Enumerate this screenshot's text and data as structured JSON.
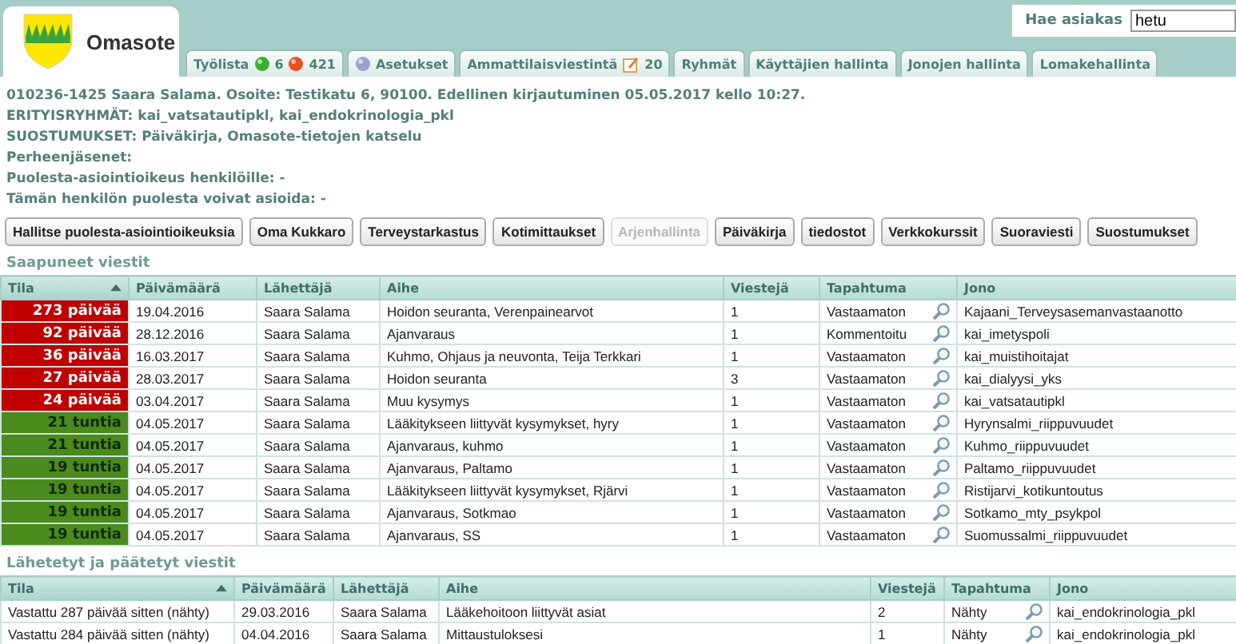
{
  "header": {
    "app_name": "Omasote",
    "search": {
      "label": "Hae asiakas",
      "value": "hetu"
    },
    "tabs": [
      {
        "kind": "worklist",
        "label": "Työlista",
        "green_count": "6",
        "red_count": "421"
      },
      {
        "kind": "settings",
        "label": "Asetukset"
      },
      {
        "kind": "messages",
        "label": "Ammattilaisviestintä",
        "count": "20"
      },
      {
        "kind": "plain",
        "label": "Ryhmät"
      },
      {
        "kind": "plain",
        "label": "Käyttäjien hallinta"
      },
      {
        "kind": "plain",
        "label": "Jonojen hallinta"
      },
      {
        "kind": "plain",
        "label": "Lomakehallinta"
      }
    ]
  },
  "patient_info": [
    "010236-1425 Saara Salama. Osoite: Testikatu 6, 90100. Edellinen kirjautuminen 05.05.2017 kello 10:27.",
    "ERITYISRYHMÄT: kai_vatsatautipkl, kai_endokrinologia_pkl",
    "SUOSTUMUKSET: Päiväkirja, Omasote-tietojen katselu",
    "Perheenjäsenet:",
    "Puolesta-asiointioikeus henkilöille: -",
    "Tämän henkilön puolesta voivat asioida: -"
  ],
  "buttons": [
    {
      "label": "Hallitse puolesta-asiointioikeuksia",
      "disabled": false
    },
    {
      "label": "Oma Kukkaro",
      "disabled": false
    },
    {
      "label": "Terveystarkastus",
      "disabled": false
    },
    {
      "label": "Kotimittaukset",
      "disabled": false
    },
    {
      "label": "Arjenhallinta",
      "disabled": true
    },
    {
      "label": "Päiväkirja",
      "disabled": false
    },
    {
      "label": "tiedostot",
      "disabled": false
    },
    {
      "label": "Verkkokurssit",
      "disabled": false
    },
    {
      "label": "Suoraviesti",
      "disabled": false
    },
    {
      "label": "Suostumukset",
      "disabled": false
    }
  ],
  "received": {
    "title": "Saapuneet viestit",
    "columns": [
      {
        "label": "Tila",
        "sorted": true
      },
      {
        "label": "Päivämäärä",
        "sorted": false
      },
      {
        "label": "Lähettäjä",
        "sorted": false
      },
      {
        "label": "Aihe",
        "sorted": false
      },
      {
        "label": "Viestejä",
        "sorted": false
      },
      {
        "label": "Tapahtuma",
        "sorted": false
      },
      {
        "label": "Jono",
        "sorted": false
      }
    ],
    "rows": [
      {
        "status": "273 päivää",
        "color": "#c00000",
        "date": "19.04.2016",
        "sender": "Saara Salama",
        "subject": "Hoidon seuranta, Verenpainearvot",
        "count": "1",
        "event": "Vastaamaton",
        "queue": "Kajaani_Terveysasemanvastaanotto"
      },
      {
        "status": "92 päivää",
        "color": "#c00000",
        "date": "28.12.2016",
        "sender": "Saara Salama",
        "subject": "Ajanvaraus",
        "count": "1",
        "event": "Kommentoitu",
        "queue": "kai_imetyspoli"
      },
      {
        "status": "36 päivää",
        "color": "#c00000",
        "date": "16.03.2017",
        "sender": "Saara Salama",
        "subject": "Kuhmo, Ohjaus ja neuvonta, Teija Terkkari",
        "count": "1",
        "event": "Vastaamaton",
        "queue": "kai_muistihoitajat"
      },
      {
        "status": "27 päivää",
        "color": "#c00000",
        "date": "28.03.2017",
        "sender": "Saara Salama",
        "subject": "Hoidon seuranta",
        "count": "3",
        "event": "Vastaamaton",
        "queue": "kai_dialyysi_yks"
      },
      {
        "status": "24 päivää",
        "color": "#c00000",
        "date": "03.04.2017",
        "sender": "Saara Salama",
        "subject": "Muu kysymys",
        "count": "1",
        "event": "Vastaamaton",
        "queue": "kai_vatsatautipkl"
      },
      {
        "status": "21 tuntia",
        "color": "#4b8a1c",
        "date": "04.05.2017",
        "sender": "Saara Salama",
        "subject": "Lääkitykseen liittyvät kysymykset, hyry",
        "count": "1",
        "event": "Vastaamaton",
        "queue": "Hyrynsalmi_riippuvuudet"
      },
      {
        "status": "21 tuntia",
        "color": "#4b8a1c",
        "date": "04.05.2017",
        "sender": "Saara Salama",
        "subject": "Ajanvaraus, kuhmo",
        "count": "1",
        "event": "Vastaamaton",
        "queue": "Kuhmo_riippuvuudet"
      },
      {
        "status": "19 tuntia",
        "color": "#4b8a1c",
        "date": "04.05.2017",
        "sender": "Saara Salama",
        "subject": "Ajanvaraus, Paltamo",
        "count": "1",
        "event": "Vastaamaton",
        "queue": "Paltamo_riippuvuudet"
      },
      {
        "status": "19 tuntia",
        "color": "#4b8a1c",
        "date": "04.05.2017",
        "sender": "Saara Salama",
        "subject": "Lääkitykseen liittyvät kysymykset, Rjärvi",
        "count": "1",
        "event": "Vastaamaton",
        "queue": "Ristijarvi_kotikuntoutus"
      },
      {
        "status": "19 tuntia",
        "color": "#4b8a1c",
        "date": "04.05.2017",
        "sender": "Saara Salama",
        "subject": "Ajanvaraus, Sotkmao",
        "count": "1",
        "event": "Vastaamaton",
        "queue": "Sotkamo_mty_psykpol"
      },
      {
        "status": "19 tuntia",
        "color": "#4b8a1c",
        "date": "04.05.2017",
        "sender": "Saara Salama",
        "subject": "Ajanvaraus, SS",
        "count": "1",
        "event": "Vastaamaton",
        "queue": "Suomussalmi_riippuvuudet"
      }
    ]
  },
  "sent": {
    "title": "Lähetetyt ja päätetyt viestit",
    "columns": [
      {
        "label": "Tila",
        "sorted": true
      },
      {
        "label": "Päivämäärä",
        "sorted": false
      },
      {
        "label": "Lähettäjä",
        "sorted": false
      },
      {
        "label": "Aihe",
        "sorted": false
      },
      {
        "label": "Viestejä",
        "sorted": false
      },
      {
        "label": "Tapahtuma",
        "sorted": false
      },
      {
        "label": "Jono",
        "sorted": false
      }
    ],
    "rows": [
      {
        "status": "Vastattu 287 päivää sitten (nähty)",
        "date": "29.03.2016",
        "sender": "Saara Salama",
        "subject": "Lääkehoitoon liittyvät asiat",
        "count": "2",
        "event": "Nähty",
        "queue": "kai_endokrinologia_pkl"
      },
      {
        "status": "Vastattu 284 päivää sitten (nähty)",
        "date": "04.04.2016",
        "sender": "Saara Salama",
        "subject": "Mittaustuloksesi",
        "count": "1",
        "event": "Nähty",
        "queue": "kai_endokrinologia_pkl"
      }
    ]
  }
}
